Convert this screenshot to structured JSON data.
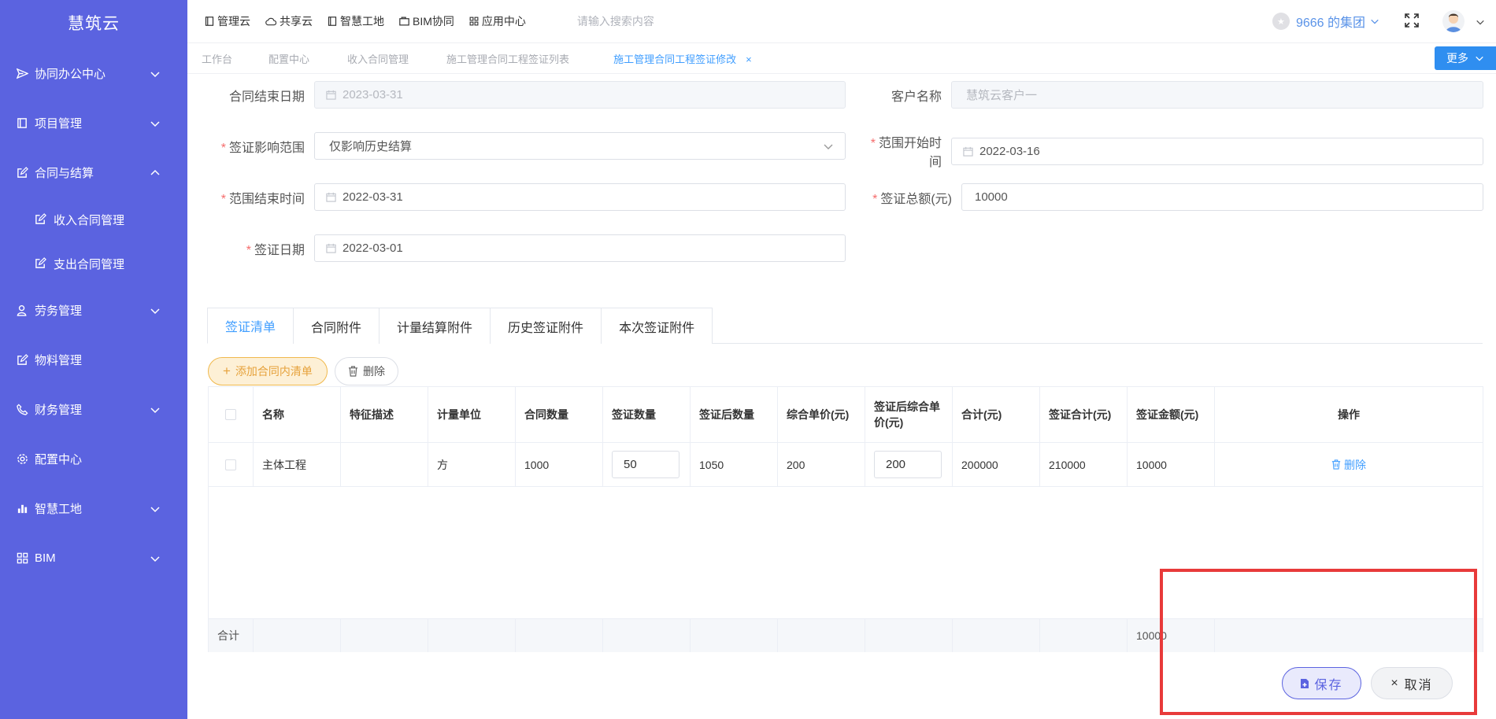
{
  "app": {
    "title": "慧筑云"
  },
  "sidebar": {
    "items": [
      {
        "label": "协同办公中心"
      },
      {
        "label": "项目管理"
      },
      {
        "label": "合同与结算"
      },
      {
        "label": "收入合同管理"
      },
      {
        "label": "支出合同管理"
      },
      {
        "label": "劳务管理"
      },
      {
        "label": "物料管理"
      },
      {
        "label": "财务管理"
      },
      {
        "label": "配置中心"
      },
      {
        "label": "智慧工地"
      },
      {
        "label": "BIM"
      }
    ]
  },
  "topbar": {
    "links": [
      "管理云",
      "共享云",
      "智慧工地",
      "BIM协同",
      "应用中心"
    ],
    "search_placeholder": "请输入搜索内容",
    "group": "9666 的集团"
  },
  "tabs": {
    "items": [
      "工作台",
      "配置中心",
      "收入合同管理",
      "施工管理合同工程签证列表",
      "施工管理合同工程签证修改"
    ],
    "close": "×",
    "more": "更多"
  },
  "form": {
    "contract_end_label": "合同结束日期",
    "contract_end_value": "2023-03-31",
    "customer_label": "客户名称",
    "customer_value": "慧筑云客户一",
    "scope_label": "签证影响范围",
    "scope_value": "仅影响历史结算",
    "range_start_label": "范围开始时间",
    "range_start_value": "2022-03-16",
    "range_end_label": "范围结束时间",
    "range_end_value": "2022-03-31",
    "total_label": "签证总额(元)",
    "total_value": "10000",
    "visa_date_label": "签证日期",
    "visa_date_value": "2022-03-01",
    "required_mark": "*"
  },
  "subtabs": [
    "签证清单",
    "合同附件",
    "计量结算附件",
    "历史签证附件",
    "本次签证附件"
  ],
  "toolbar": {
    "add": "添加合同内清单",
    "delete": "删除"
  },
  "table": {
    "headers": [
      "名称",
      "特征描述",
      "计量单位",
      "合同数量",
      "签证数量",
      "签证后数量",
      "综合单价(元)",
      "签证后综合单价(元)",
      "合计(元)",
      "签证合计(元)",
      "签证金额(元)",
      "操作"
    ],
    "row": {
      "name": "主体工程",
      "desc": "",
      "unit": "方",
      "contract_qty": "1000",
      "visa_qty": "50",
      "after_qty": "1050",
      "unit_price": "200",
      "after_price": "200",
      "total": "200000",
      "visa_total": "210000",
      "visa_amount": "10000",
      "op": "删除"
    },
    "footer": {
      "label": "合计",
      "visa_amount": "10000"
    }
  },
  "actions": {
    "save": "保存",
    "cancel": "取消"
  },
  "colors": {
    "sidebar": "#5b63e0",
    "accent": "#409eff",
    "highlight": "#e83a3a"
  }
}
